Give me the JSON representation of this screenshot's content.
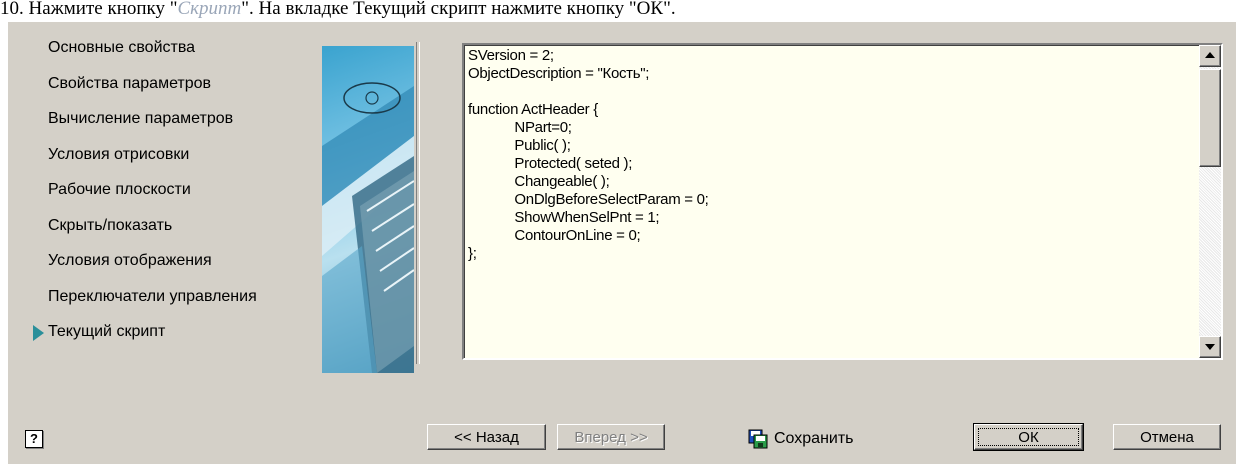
{
  "doc_instruction": {
    "prefix": "10. Нажмите кнопку \"",
    "grey_word": "Скрипт",
    "suffix": "\". На вкладке Текущий скрипт нажмите кнопку \"ОК\"."
  },
  "nav": {
    "items": [
      {
        "label": "Основные свойства"
      },
      {
        "label": "Свойства параметров"
      },
      {
        "label": "Вычисление параметров"
      },
      {
        "label": "Условия отрисовки"
      },
      {
        "label": "Рабочие плоскости"
      },
      {
        "label": "Скрыть/показать"
      },
      {
        "label": "Условия отображения"
      },
      {
        "label": "Переключатели управления"
      },
      {
        "label": "Текущий скрипт",
        "active": true
      }
    ]
  },
  "editor": {
    "code": "SVersion = 2;\nObjectDescription = \"Кость\";\n\nfunction ActHeader {\n\t\tNPart=0;\n\t\tPublic( );\n\t\tProtected( seted );\n\t\tChangeable( );\n\t\tOnDlgBeforeSelectParam = 0;\n\t\tShowWhenSelPnt = 1;\n\t\tContourOnLine = 0;\n};"
  },
  "buttons": {
    "back": "<< Назад",
    "next": "Вперед >>",
    "save": "Сохранить",
    "ok": "ОК",
    "cancel": "Отмена",
    "help": "?"
  },
  "colors": {
    "dialog_bg": "#d4d0c8",
    "editor_bg": "#fffff0",
    "active_arrow": "#2a8f9a"
  }
}
